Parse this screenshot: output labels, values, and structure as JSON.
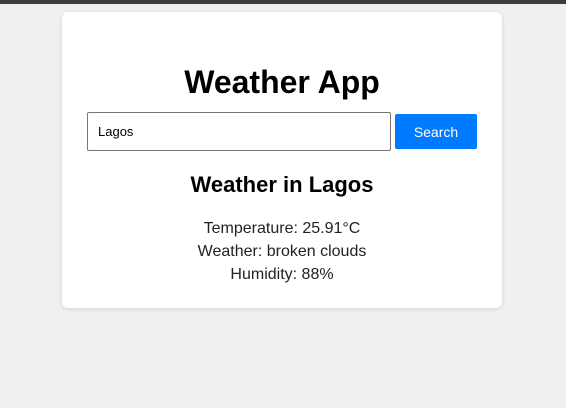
{
  "app": {
    "title": "Weather App"
  },
  "search": {
    "value": "Lagos",
    "button_label": "Search"
  },
  "result": {
    "heading": "Weather in Lagos",
    "temperature": "Temperature: 25.91°C",
    "weather": "Weather: broken clouds",
    "humidity": "Humidity: 88%"
  },
  "colors": {
    "accent": "#007bff",
    "background": "#f0f0f0",
    "card": "#ffffff"
  }
}
